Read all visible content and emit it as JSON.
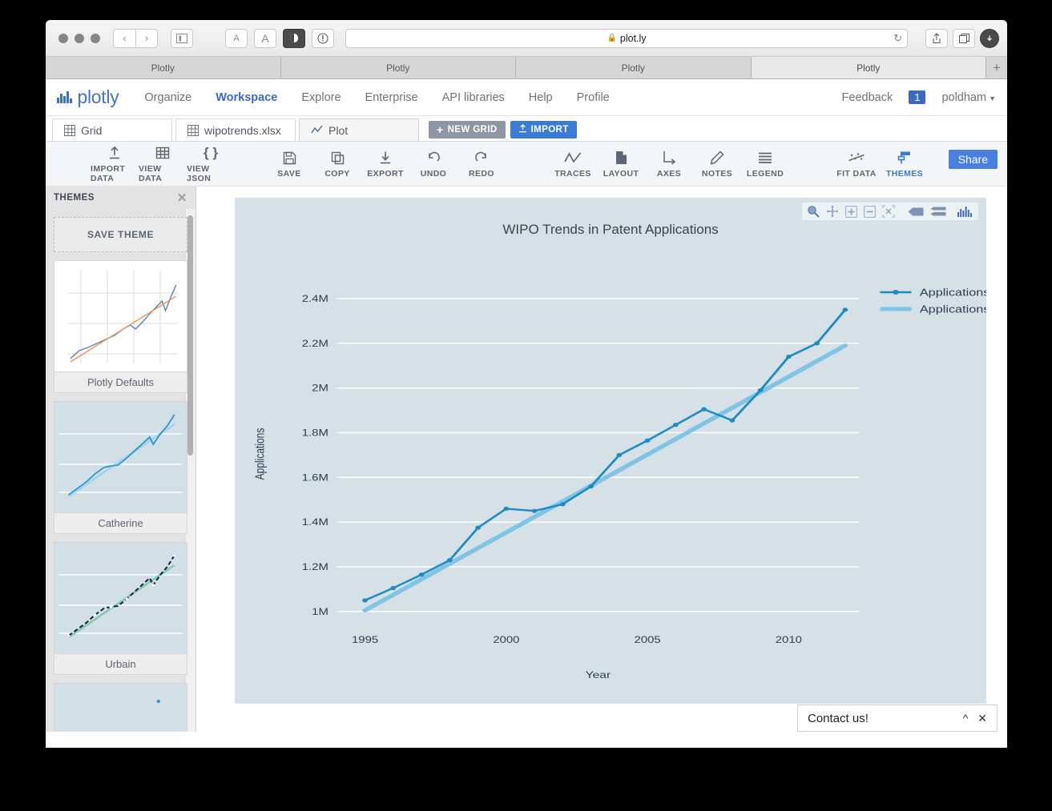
{
  "browser": {
    "url": "plot.ly",
    "lock_icon": "lock-icon",
    "reload_icon": "reload-icon",
    "back_icon": "back-chevron-icon",
    "forward_icon": "forward-chevron-icon",
    "sidebar_icon": "sidebar-toggle-icon",
    "reader_small_icon": "text-size-small-icon",
    "reader_large_icon": "text-size-large-icon",
    "reader_icon": "reader-view-icon",
    "privacy_icon": "privacy-report-icon",
    "share_icon": "share-icon",
    "tabs_icon": "show-all-tabs-icon",
    "downloads_icon": "downloads-icon",
    "new_tab_label": "+",
    "tabs": [
      {
        "title": "Plotly",
        "active": false
      },
      {
        "title": "Plotly",
        "active": false
      },
      {
        "title": "Plotly",
        "active": false
      },
      {
        "title": "Plotly",
        "active": true
      }
    ]
  },
  "navbar": {
    "brand": "plotly",
    "links": [
      {
        "label": "Organize",
        "active": false
      },
      {
        "label": "Workspace",
        "active": true
      },
      {
        "label": "Explore",
        "active": false
      },
      {
        "label": "Enterprise",
        "active": false
      },
      {
        "label": "API libraries",
        "active": false
      },
      {
        "label": "Help",
        "active": false
      },
      {
        "label": "Profile",
        "active": false
      }
    ],
    "feedback": "Feedback",
    "notification_count": "1",
    "user": "poldham"
  },
  "filetabs": {
    "tabs": [
      {
        "label": "Grid",
        "icon": "grid-icon",
        "active": false
      },
      {
        "label": "wipotrends.xlsx",
        "icon": "grid-icon",
        "active": false
      },
      {
        "label": "Plot",
        "icon": "chart-line-icon",
        "active": true
      }
    ],
    "new_grid": "NEW GRID",
    "import": "IMPORT"
  },
  "toolbar": {
    "group1": [
      {
        "label": "IMPORT DATA",
        "icon": "upload-icon"
      },
      {
        "label": "VIEW DATA",
        "icon": "grid-icon"
      },
      {
        "label": "VIEW JSON",
        "icon": "braces-icon"
      }
    ],
    "group2": [
      {
        "label": "SAVE",
        "icon": "floppy-disk-icon"
      },
      {
        "label": "COPY",
        "icon": "copy-icon"
      },
      {
        "label": "EXPORT",
        "icon": "download-icon"
      },
      {
        "label": "UNDO",
        "icon": "undo-arrow-icon"
      },
      {
        "label": "REDO",
        "icon": "redo-arrow-icon"
      }
    ],
    "group3": [
      {
        "label": "TRACES",
        "icon": "zigzag-icon"
      },
      {
        "label": "LAYOUT",
        "icon": "page-icon"
      },
      {
        "label": "AXES",
        "icon": "axes-icon"
      },
      {
        "label": "NOTES",
        "icon": "pencil-icon"
      },
      {
        "label": "LEGEND",
        "icon": "lines-icon"
      }
    ],
    "group4": [
      {
        "label": "FIT DATA",
        "icon": "fit-data-icon",
        "active": false
      },
      {
        "label": "THEMES",
        "icon": "themes-icon",
        "active": true
      }
    ],
    "share": "Share"
  },
  "sidebar": {
    "title": "THEMES",
    "close_icon": "close-icon",
    "save_theme": "SAVE THEME",
    "themes": [
      {
        "name": "Plotly Defaults",
        "bg": "#ffffff",
        "line": "#5b8bbf",
        "fit": "#f3955a",
        "grid": "#d8d8d8"
      },
      {
        "name": "Catherine",
        "bg": "#d3dfe6",
        "line": "#2d95cf",
        "fit": "#9ed4ee",
        "grid": "#ffffff"
      },
      {
        "name": "Urbain",
        "bg": "#d3dfe6",
        "line": "#141f45",
        "fit": "#86cbae",
        "grid": "#ffffff"
      }
    ]
  },
  "chart_data": {
    "type": "line",
    "title": "WIPO Trends in Patent Applications",
    "xlabel": "Year",
    "ylabel": "Applications",
    "xlim": [
      1994,
      2012.5
    ],
    "ylim": [
      960000,
      2450000
    ],
    "xticks": [
      "1995",
      "2000",
      "2005",
      "2010"
    ],
    "xtickvals": [
      1995,
      2000,
      2005,
      2010
    ],
    "yticks": [
      "1M",
      "1.2M",
      "1.4M",
      "1.6M",
      "1.8M",
      "2M",
      "2.2M",
      "2.4M"
    ],
    "ytickvals": [
      1000000,
      1200000,
      1400000,
      1600000,
      1800000,
      2000000,
      2200000,
      2400000
    ],
    "grid": true,
    "grid_color": "#ffffff",
    "plot_bgcolor": "#d6e0e7",
    "legend_position": "top-right",
    "series": [
      {
        "name": "Applications",
        "color": "#1f8bc4",
        "mode": "lines+markers",
        "x": [
          1995,
          1996,
          1997,
          1998,
          1999,
          2000,
          2001,
          2002,
          2003,
          2004,
          2005,
          2006,
          2007,
          2008,
          2009,
          2010,
          2011,
          2012
        ],
        "y": [
          1050000,
          1105000,
          1165000,
          1230000,
          1375000,
          1460000,
          1450000,
          1480000,
          1560000,
          1700000,
          1765000,
          1835000,
          1905000,
          1855000,
          1990000,
          2140000,
          2200000,
          2350000
        ]
      },
      {
        "name": "Applications - fit",
        "color": "#7fc4e4",
        "mode": "lines",
        "x": [
          1995,
          2012
        ],
        "y": [
          1005000,
          2190000
        ]
      }
    ],
    "modebar": [
      {
        "icon": "zoom-icon",
        "label": "Zoom"
      },
      {
        "icon": "pan-icon",
        "label": "Pan"
      },
      {
        "icon": "zoom-in-icon",
        "label": "Zoom in"
      },
      {
        "icon": "zoom-out-icon",
        "label": "Zoom out"
      },
      {
        "icon": "autoscale-icon",
        "label": "Autoscale"
      },
      {
        "icon": "hover-closest-icon",
        "label": "Show closest data on hover"
      },
      {
        "icon": "hover-compare-icon",
        "label": "Compare data on hover"
      },
      {
        "icon": "plotly-logo-icon",
        "label": "Produced with Plotly"
      }
    ]
  },
  "contact": {
    "label": "Contact us!",
    "collapse_icon": "chevron-up-icon",
    "close_icon": "close-icon"
  }
}
